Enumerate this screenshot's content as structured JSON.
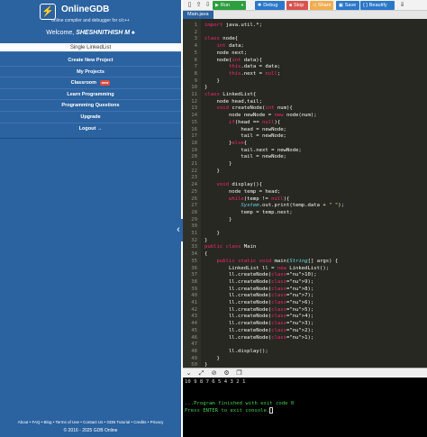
{
  "brand": {
    "name": "OnlineGDB",
    "tagline": "online compiler and debugger for c/c++",
    "logo_icon": "bolt-icon"
  },
  "welcome": {
    "prefix": "Welcome,",
    "user": "SHESHNITHISH M",
    "suffix": "♠"
  },
  "menu": [
    {
      "label": "Single LinkedList",
      "active": true
    },
    {
      "label": "Create New Project"
    },
    {
      "label": "My Projects"
    },
    {
      "label": "Classroom",
      "badge": "new"
    },
    {
      "label": "Learn Programming"
    },
    {
      "label": "Programming Questions"
    },
    {
      "label": "Upgrade"
    },
    {
      "label": "Logout",
      "suffix": "→"
    }
  ],
  "footer": {
    "links": "About • FAQ • Blog • Terms of Use • Contact Us • GDB Tutorial • Credits • Privacy",
    "copyright": "© 2016 - 2025 GDB Online"
  },
  "toolbar": {
    "run": "Run",
    "debug": "Debug",
    "stop": "Stop",
    "share": "Share",
    "save": "Save",
    "beautify": "{ } Beautify"
  },
  "tab": {
    "label": "Main.java"
  },
  "editor": {
    "lines": [
      "import java.util.*;",
      "",
      "class node{",
      "    int data;",
      "    node next;",
      "    node(int data){",
      "        this.data = data;",
      "        this.next = null;",
      "    }",
      "}",
      "class LinkedList{",
      "    node head,tail;",
      "    void createNode(int num){",
      "        node newNode = new node(num);",
      "        if(head == null){",
      "            head = newNode;",
      "            tail = newNode;",
      "        }else{",
      "            tail.next = newNode;",
      "            tail = newNode;",
      "        }",
      "    }",
      "",
      "    void display(){",
      "        node temp = head;",
      "        while(temp != null){",
      "            System.out.print(temp.data + \" \");",
      "            temp = temp.next;",
      "        }",
      "",
      "    }",
      "}",
      "public class Main",
      "{",
      "    public static void main(String[] args) {",
      "        LinkedList ll = new LinkedList();",
      "        ll.createNode(10);",
      "        ll.createNode(9);",
      "        ll.createNode(8);",
      "        ll.createNode(7);",
      "        ll.createNode(6);",
      "        ll.createNode(5);",
      "        ll.createNode(4);",
      "        ll.createNode(3);",
      "        ll.createNode(2);",
      "        ll.createNode(1);",
      "",
      "        ll.display();",
      "    }",
      "}",
      ""
    ]
  },
  "output": {
    "lines": [
      "10 9 8 7 6 5 4 3 2 1",
      "",
      "",
      "...Program finished with exit code 0",
      "Press ENTER to exit console."
    ]
  }
}
